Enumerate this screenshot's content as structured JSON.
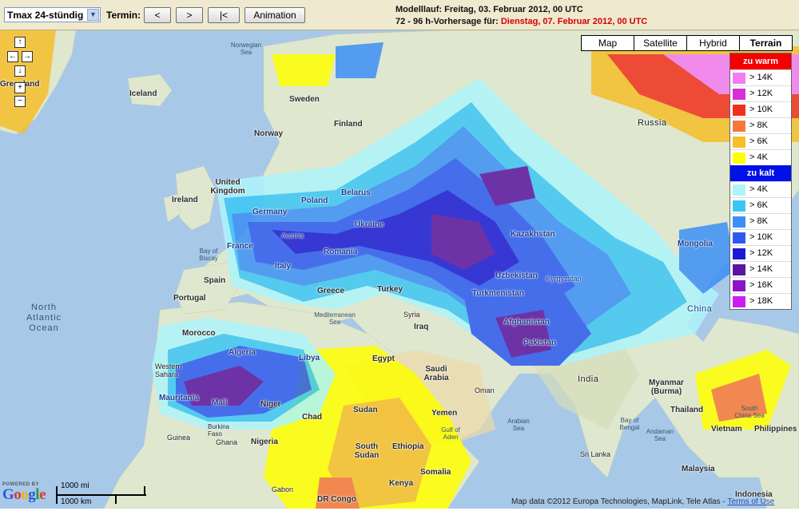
{
  "toolbar": {
    "product": "Tmax 24-stündig",
    "termin_label": "Termin:",
    "prev_label": "<",
    "next_label": ">",
    "first_label": "|<",
    "animation_label": "Animation",
    "run_line": "Modelllauf: Freitag, 03. Februar 2012, 00 UTC",
    "forecast_prefix": "72 - 96 h-Vorhersage für:",
    "forecast_date": "Dienstag, 07. Februar 2012, 00 UTC"
  },
  "map_types": [
    "Map",
    "Satellite",
    "Hybrid",
    "Terrain"
  ],
  "map_type_active": "Terrain",
  "legend": {
    "warm_title": "zu warm",
    "warm": [
      {
        "label": "> 14K",
        "color": "#f47cf0"
      },
      {
        "label": "> 12K",
        "color": "#d62fd6"
      },
      {
        "label": "> 10K",
        "color": "#f0301c"
      },
      {
        "label": "> 8K",
        "color": "#f5783a"
      },
      {
        "label": "> 6K",
        "color": "#f5be2a"
      },
      {
        "label": "> 4K",
        "color": "#ffff00"
      }
    ],
    "cold_title": "zu kalt",
    "cold": [
      {
        "label": "> 4K",
        "color": "#aef4fa"
      },
      {
        "label": "> 6K",
        "color": "#3cc6f5"
      },
      {
        "label": "> 8K",
        "color": "#3c8ff5"
      },
      {
        "label": "> 10K",
        "color": "#2c5af0"
      },
      {
        "label": "> 12K",
        "color": "#1a1ad6"
      },
      {
        "label": "> 14K",
        "color": "#5a14a0"
      },
      {
        "label": "> 16K",
        "color": "#8c14c8"
      },
      {
        "label": "> 18K",
        "color": "#c81ef0"
      }
    ]
  },
  "labels": {
    "greenland": "Greenland",
    "norwegian_sea": "Norwegian Sea",
    "iceland": "Iceland",
    "sweden": "Sweden",
    "finland": "Finland",
    "norway": "Norway",
    "russia": "Russia",
    "united_kingdom": "United Kingdom",
    "ireland": "Ireland",
    "belarus": "Belarus",
    "germany": "Germany",
    "poland": "Poland",
    "austria": "Austria",
    "ukraine": "Ukraine",
    "kazakhstan": "Kazakhstan",
    "mongolia": "Mongolia",
    "bay_of_biscay": "Bay of Biscay",
    "france": "France",
    "romania": "Romania",
    "italy": "Italy",
    "spain": "Spain",
    "uzbekistan": "Uzbekistan",
    "kyrgyzstan": "Kyrgyzstan",
    "portugal": "Portugal",
    "greece": "Greece",
    "turkey": "Turkey",
    "turkmenistan": "Turkmenistan",
    "north_atlantic": "North Atlantic Ocean",
    "mediterranean": "Mediterranean Sea",
    "syria": "Syria",
    "iraq": "Iraq",
    "afghanistan": "Afghanistan",
    "china": "China",
    "morocco": "Morocco",
    "pakistan": "Pakistan",
    "algeria": "Algeria",
    "libya": "Libya",
    "egypt": "Egypt",
    "western_sahara": "Western Sahara",
    "saudi_arabia": "Saudi Arabia",
    "india": "India",
    "mauritania": "Mauritania",
    "mali": "Mali",
    "niger": "Niger",
    "oman": "Oman",
    "myanmar": "Myanmar (Burma)",
    "chad": "Chad",
    "sudan": "Sudan",
    "yemen": "Yemen",
    "arabian_sea": "Arabian Sea",
    "bay_of_bengal": "Bay of Bengal",
    "thailand": "Thailand",
    "south_china_sea": "South China Sea",
    "guinea": "Guinea",
    "ghana": "Ghana",
    "nigeria": "Nigeria",
    "burkina_faso": "Burkina Faso",
    "gulf_of_aden": "Gulf of Aden",
    "south_sudan": "South Sudan",
    "ethiopia": "Ethiopia",
    "vietnam": "Vietnam",
    "philippines": "Philippines",
    "andaman_sea": "Andaman Sea",
    "sri_lanka": "Sri Lanka",
    "malaysia": "Malaysia",
    "gabon": "Gabon",
    "kenya": "Kenya",
    "somalia": "Somalia",
    "dr_congo": "DR Congo",
    "indonesia": "Indonesia"
  },
  "scale": {
    "mi": "1000 mi",
    "km": "1000 km"
  },
  "powered_by": "POWERED BY",
  "google": "Google",
  "attribution": "Map data ©2012 Europa Technologies, MapLink, Tele Atlas -",
  "terms": "Terms of Use"
}
